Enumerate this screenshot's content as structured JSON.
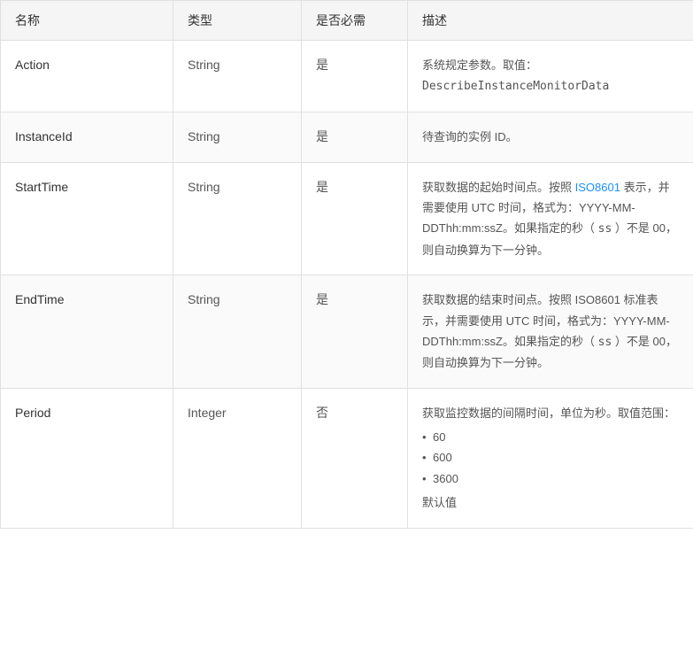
{
  "table": {
    "headers": {
      "name": "名称",
      "type": "类型",
      "required": "是否必需",
      "description": "描述"
    },
    "rows": [
      {
        "name": "Action",
        "type": "String",
        "required": "是",
        "description_parts": [
          {
            "text": "系统规定参数。取值："
          },
          {
            "text": "DescribeInstanceMonitorData",
            "type": "code"
          }
        ],
        "description_plain": "系统规定参数。取值：DescribeInstanceMonitorData"
      },
      {
        "name": "InstanceId",
        "type": "String",
        "required": "是",
        "description_parts": [
          {
            "text": "待查询的实例 ID。"
          }
        ],
        "description_plain": "待查询的实例 ID。"
      },
      {
        "name": "StartTime",
        "type": "String",
        "required": "是",
        "description_parts": [
          {
            "text": "获取数据的起始时间点。按照 "
          },
          {
            "text": "ISO8601",
            "type": "link",
            "href": "#"
          },
          {
            "text": " 表示，并需要使用 UTC 时间，格式为：YYYY-MM-DDThh:mm:ssZ。如果指定的秒（ "
          },
          {
            "text": "ss",
            "type": "code_inline"
          },
          {
            "text": " ）不是 00，则自动换算为下一分钟。"
          }
        ],
        "description_plain": "获取数据的起始时间点。按照 ISO8601 表示，并需要使用 UTC 时间，格式为：YYYY-MM-DDThh:mm:ssZ。如果指定的秒（ ss ）不是 00，则自动换算为下一分钟。"
      },
      {
        "name": "EndTime",
        "type": "String",
        "required": "是",
        "description_parts": [
          {
            "text": "获取数据的结束时间点。按照 ISO8601 标准表示，并需要使用 UTC 时间，格式为：YYYY-MM-DDThh:mm:ssZ。如果指定的秒（ "
          },
          {
            "text": "ss",
            "type": "code_inline"
          },
          {
            "text": " ）不是 00，则自动换算为下一分钟。"
          }
        ],
        "description_plain": "获取数据的结束时间点。按照 ISO8601 标准表示，并需要使用 UTC 时间，格式为：YYYY-MM-DDThh:mm:ssZ。如果指定的秒（ ss ）不是 00，则自动换算为下一分钟。"
      },
      {
        "name": "Period",
        "type": "Integer",
        "required": "否",
        "description_prefix": "获取监控数据的间隔时间，单位为秒。取值范围：",
        "description_bullets": [
          "60",
          "600",
          "3600"
        ],
        "description_suffix": "默认值"
      }
    ]
  }
}
